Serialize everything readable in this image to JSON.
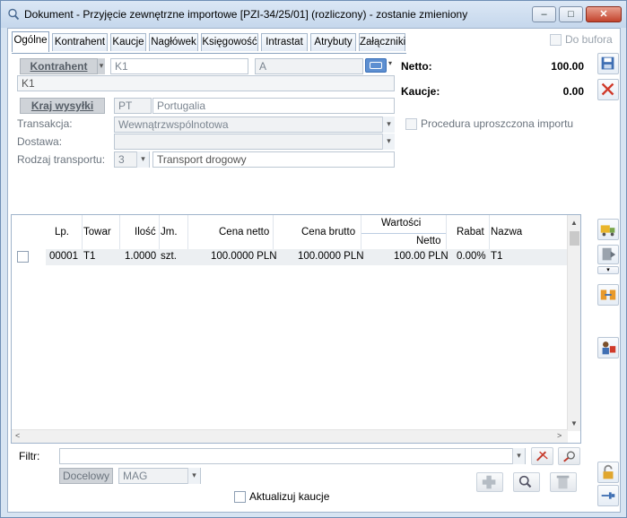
{
  "window": {
    "title": "Dokument - Przyjęcie zewnętrzne importowe [PZI-34/25/01] (rozliczony) - zostanie zmieniony",
    "minimize_glyph": "–",
    "maximize_glyph": "□",
    "close_glyph": "✕"
  },
  "tabs": [
    {
      "label": "Ogólne"
    },
    {
      "label": "Kontrahent"
    },
    {
      "label": "Kaucje"
    },
    {
      "label": "Nagłówek"
    },
    {
      "label": "Księgowość"
    },
    {
      "label": "Intrastat"
    },
    {
      "label": "Atrybuty"
    },
    {
      "label": "Załączniki"
    }
  ],
  "do_bufora": {
    "label": "Do bufora",
    "checked": false
  },
  "form": {
    "kontrahent_button": "Kontrahent",
    "kontrahent_code": "K1",
    "kontrahent_type": "A",
    "kontrahent_name": "K1",
    "kraj_button": "Kraj wysyłki",
    "kraj_code": "PT",
    "kraj_name": "Portugalia",
    "transakcja_label": "Transakcja:",
    "transakcja_value": "Wewnątrzwspólnotowa",
    "dostawa_label": "Dostawa:",
    "dostawa_value": "",
    "transport_label": "Rodzaj transportu:",
    "transport_code": "3",
    "transport_name": "Transport drogowy",
    "procedura_label": "Procedura uproszczona importu"
  },
  "summary": {
    "netto_label": "Netto:",
    "netto_value": "100.00",
    "kaucje_label": "Kaucje:",
    "kaucje_value": "0.00"
  },
  "grid": {
    "columns": {
      "lp": "Lp.",
      "towar": "Towar",
      "ilosc": "Ilość",
      "jm": "Jm.",
      "cena_netto": "Cena netto",
      "cena_brutto": "Cena brutto",
      "wartosci": "Wartości",
      "netto": "Netto",
      "rabat": "Rabat",
      "nazwa": "Nazwa"
    },
    "rows": [
      {
        "lp": "00001",
        "towar": "T1",
        "ilosc": "1.0000",
        "jm": "szt.",
        "cena_netto": "100.0000 PLN",
        "cena_brutto": "100.0000 PLN",
        "netto": "100.00 PLN",
        "rabat": "0.00%",
        "nazwa": "T1"
      }
    ]
  },
  "filter": {
    "label": "Filtr:",
    "value": "",
    "docelowy_button": "Docelowy",
    "magazyn": "MAG"
  },
  "aktualizuj": {
    "label": "Aktualizuj kaucje",
    "checked": false
  },
  "colors": {
    "accent": "#4a7bbf",
    "close": "#c3432c",
    "window_bg": "#d7e4f2"
  }
}
